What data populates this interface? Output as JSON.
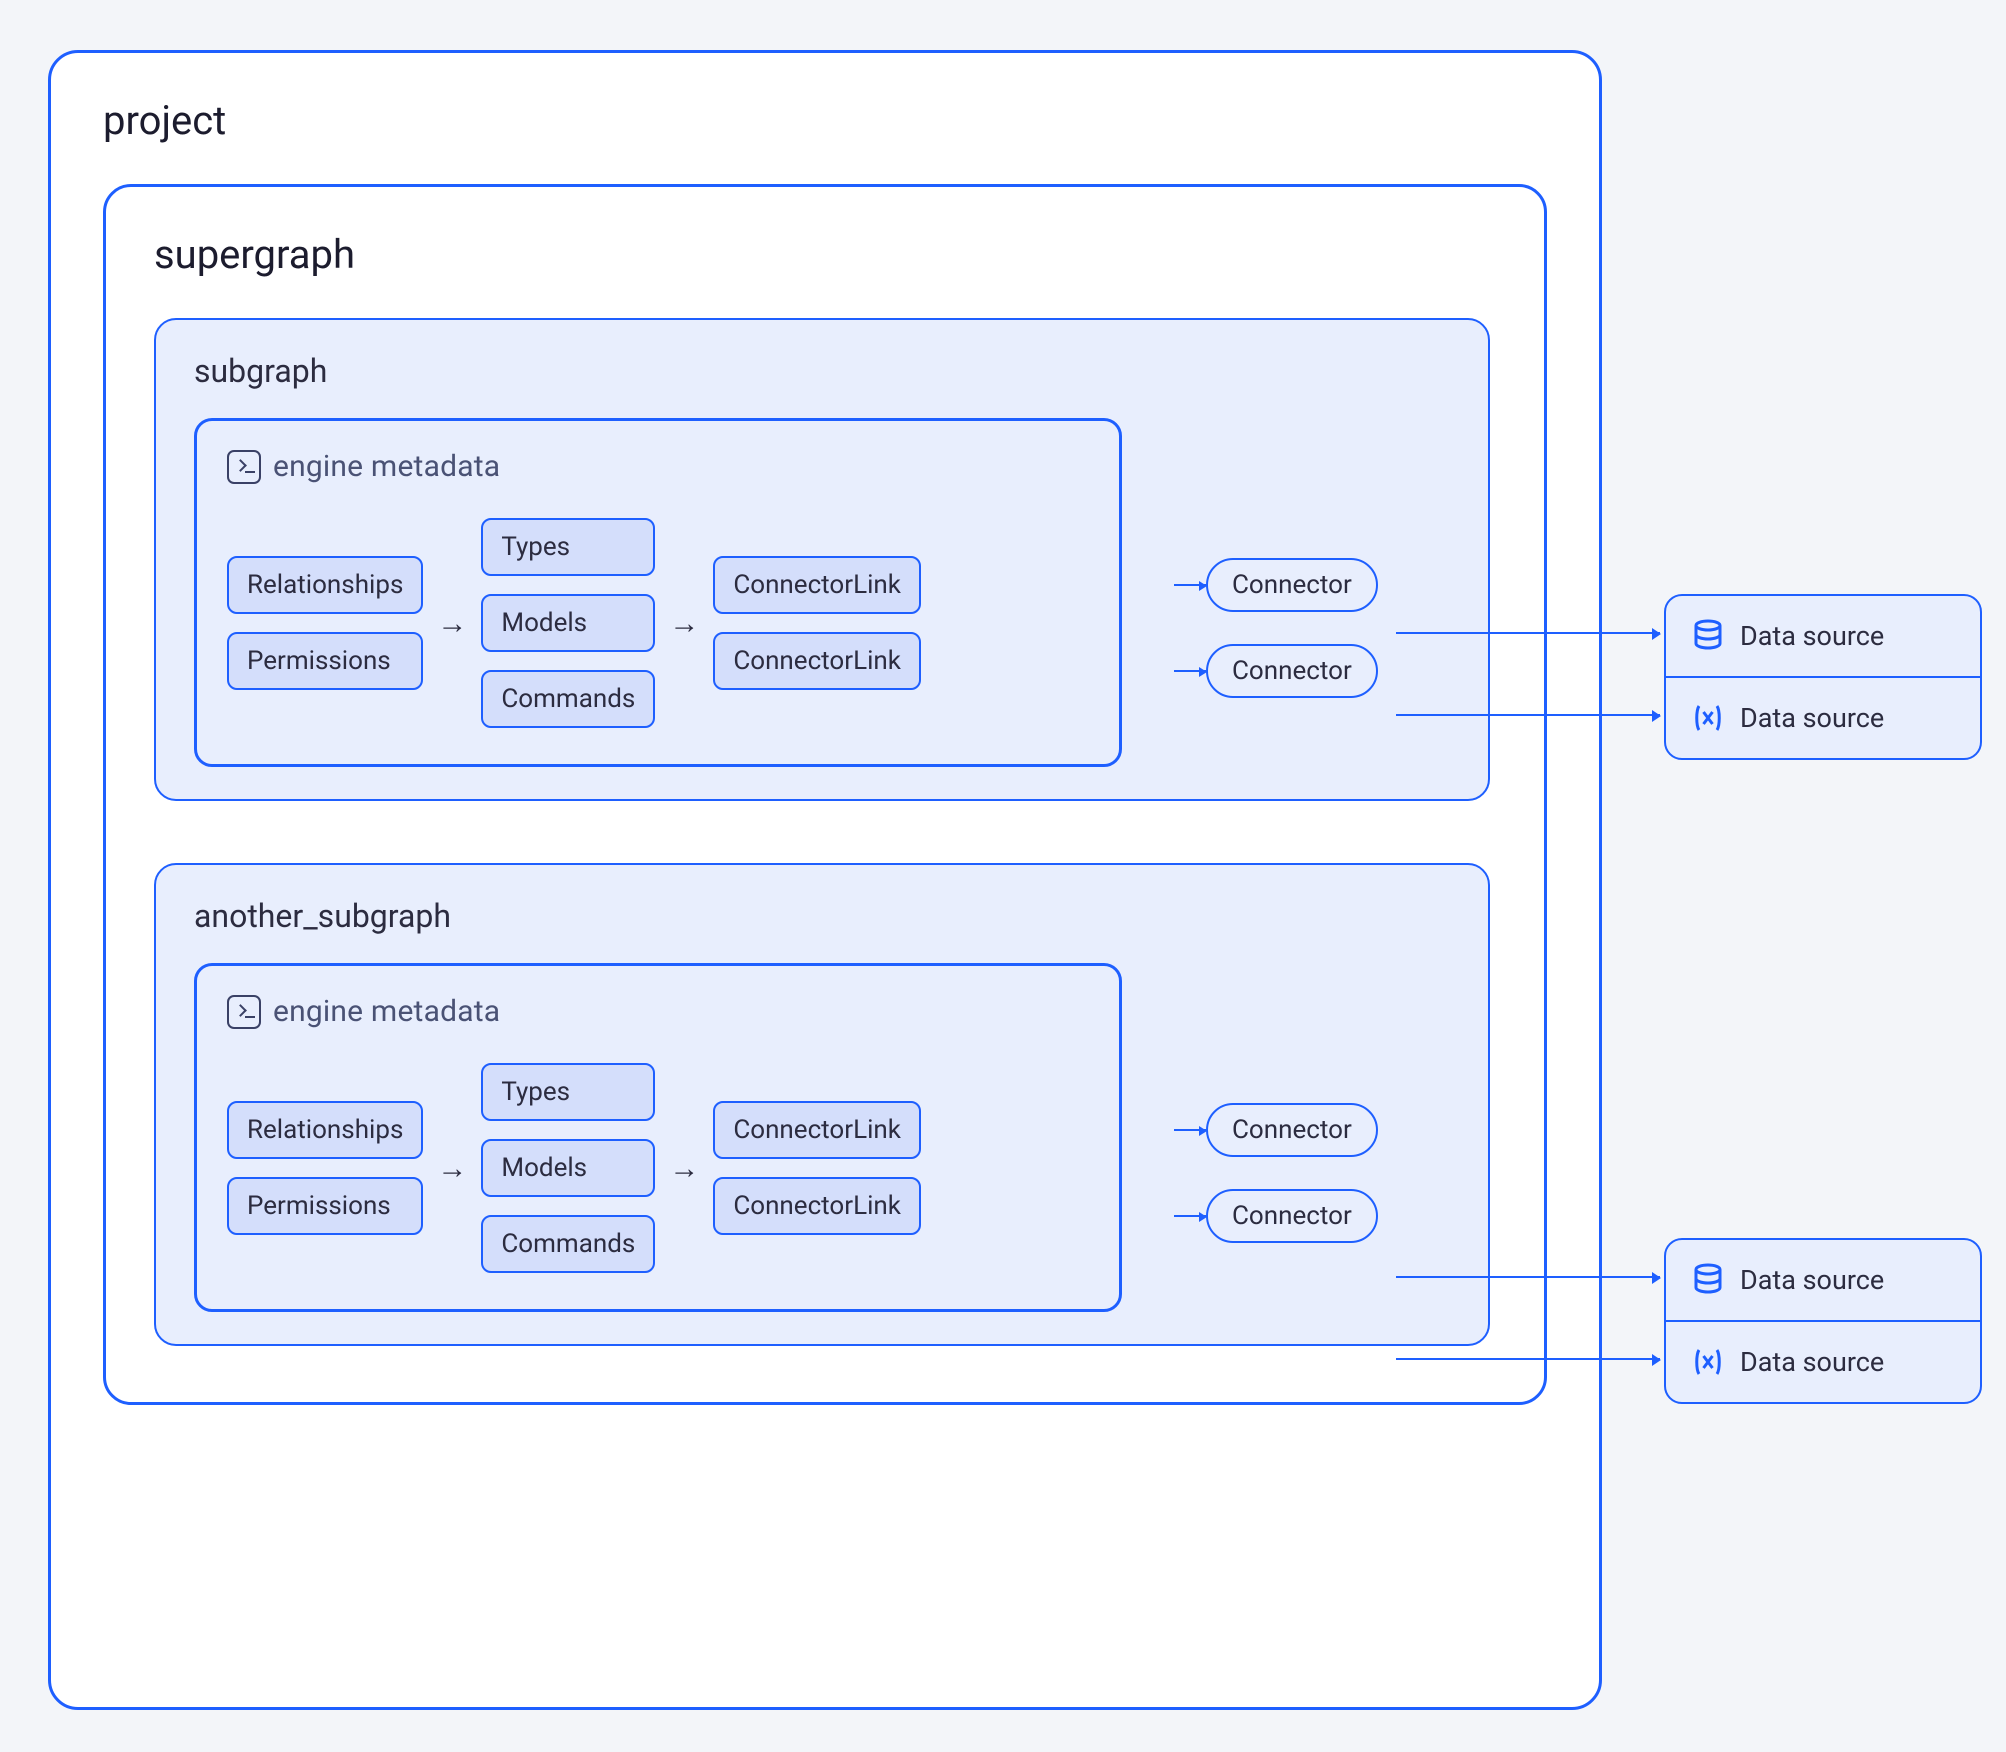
{
  "project": {
    "title": "project"
  },
  "supergraph": {
    "title": "supergraph"
  },
  "subgraphs": [
    {
      "title": "subgraph",
      "metadata_label": "engine metadata",
      "groups": {
        "a": [
          "Relationships",
          "Permissions"
        ],
        "b": [
          "Types",
          "Models",
          "Commands"
        ],
        "c": [
          "ConnectorLink",
          "ConnectorLink"
        ]
      },
      "connectors": [
        "Connector",
        "Connector"
      ]
    },
    {
      "title": "another_subgraph",
      "metadata_label": "engine metadata",
      "groups": {
        "a": [
          "Relationships",
          "Permissions"
        ],
        "b": [
          "Types",
          "Models",
          "Commands"
        ],
        "c": [
          "ConnectorLink",
          "ConnectorLink"
        ]
      },
      "connectors": [
        "Connector",
        "Connector"
      ]
    }
  ],
  "data_sources": [
    {
      "items": [
        {
          "icon": "db",
          "label": "Data source"
        },
        {
          "icon": "var",
          "label": "Data source"
        }
      ]
    },
    {
      "items": [
        {
          "icon": "db",
          "label": "Data source"
        },
        {
          "icon": "var",
          "label": "Data source"
        }
      ]
    }
  ],
  "arrow_glyph": "→"
}
